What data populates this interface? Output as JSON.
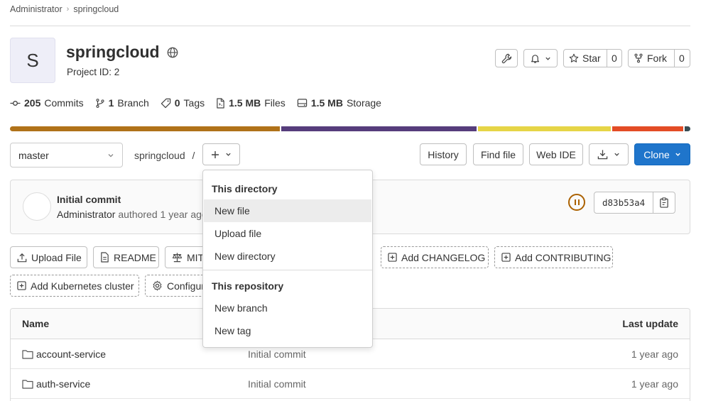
{
  "breadcrumb": [
    "Administrator",
    "springcloud"
  ],
  "project": {
    "avatar_letter": "S",
    "name": "springcloud",
    "id_text": "Project ID: 2"
  },
  "header_actions": {
    "star_label": "Star",
    "star_count": "0",
    "fork_label": "Fork",
    "fork_count": "0"
  },
  "stats": {
    "commits_num": "205",
    "commits_label": "Commits",
    "branch_num": "1",
    "branch_label": "Branch",
    "tags_num": "0",
    "tags_label": "Tags",
    "files_num": "1.5 MB",
    "files_label": "Files",
    "storage_num": "1.5 MB",
    "storage_label": "Storage"
  },
  "languages": [
    {
      "color": "#b07219",
      "share": 39.6
    },
    {
      "color": "#563d7c",
      "share": 28.7
    },
    {
      "color": "#e6d547",
      "share": 19.5
    },
    {
      "color": "#e34c26",
      "share": 10.5
    },
    {
      "color": "#384d54",
      "share": 0.8
    }
  ],
  "toolbar": {
    "branch": "master",
    "path": "springcloud",
    "path_sep": "/",
    "history": "History",
    "find_file": "Find file",
    "web_ide": "Web IDE",
    "clone": "Clone"
  },
  "commit": {
    "title": "Initial commit",
    "author": "Administrator",
    "authored_text": "authored 1 year ago",
    "sha": "d83b53a4"
  },
  "actions": {
    "upload_file": "Upload File",
    "readme": "README",
    "license": "MIT License",
    "changelog": "Add CHANGELOG",
    "contributing": "Add CONTRIBUTING",
    "kubernetes": "Add Kubernetes cluster",
    "configure": "Configure Integrations"
  },
  "dropdown": {
    "dir_header": "This directory",
    "new_file": "New file",
    "upload_file": "Upload file",
    "new_directory": "New directory",
    "repo_header": "This repository",
    "new_branch": "New branch",
    "new_tag": "New tag"
  },
  "table": {
    "col_name": "Name",
    "col_last_update": "Last update",
    "rows": [
      {
        "name": "account-service",
        "commit": "Initial commit",
        "updated": "1 year ago"
      },
      {
        "name": "auth-service",
        "commit": "Initial commit",
        "updated": "1 year ago"
      }
    ]
  }
}
